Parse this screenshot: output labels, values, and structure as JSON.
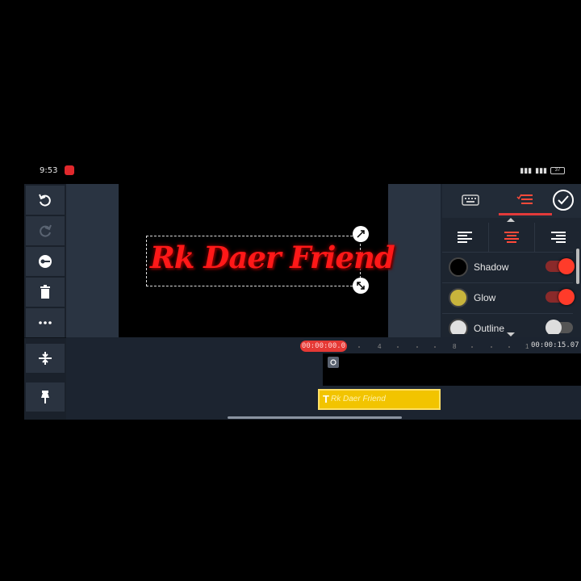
{
  "status_bar": {
    "time": "9:53",
    "battery": "37"
  },
  "preview": {
    "title_text": "Rk Daer Friend"
  },
  "right_panel": {
    "options": [
      {
        "label": "Shadow",
        "swatch": "#000000",
        "enabled": true
      },
      {
        "label": "Glow",
        "swatch": "#c8b43c",
        "enabled": true
      },
      {
        "label": "Outline",
        "swatch": "#e0e0e0",
        "enabled": false
      }
    ]
  },
  "timeline": {
    "current_time": "00:00:00.0",
    "end_time": "00:00:15.07",
    "ticks": [
      "4",
      "8",
      "1"
    ],
    "clip_label": "Rk Daer Friend"
  },
  "colors": {
    "accent": "#e53935",
    "clip": "#f2c400"
  }
}
